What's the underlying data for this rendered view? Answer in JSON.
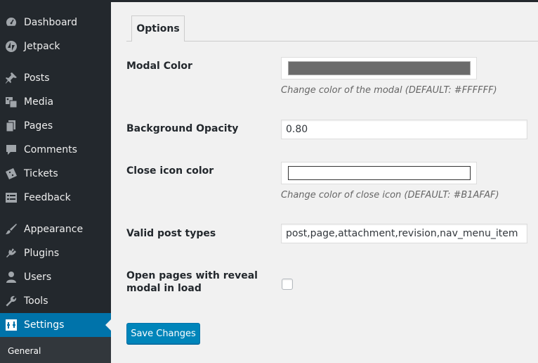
{
  "sidebar": {
    "items": [
      {
        "label": "Dashboard",
        "icon": "dashboard-icon"
      },
      {
        "label": "Jetpack",
        "icon": "jetpack-icon"
      },
      {
        "label": "Posts",
        "icon": "pin-icon"
      },
      {
        "label": "Media",
        "icon": "media-icon"
      },
      {
        "label": "Pages",
        "icon": "pages-icon"
      },
      {
        "label": "Comments",
        "icon": "comment-icon"
      },
      {
        "label": "Tickets",
        "icon": "tickets-icon"
      },
      {
        "label": "Feedback",
        "icon": "feedback-icon"
      },
      {
        "label": "Appearance",
        "icon": "brush-icon"
      },
      {
        "label": "Plugins",
        "icon": "plug-icon"
      },
      {
        "label": "Users",
        "icon": "user-icon"
      },
      {
        "label": "Tools",
        "icon": "wrench-icon"
      },
      {
        "label": "Settings",
        "icon": "settings-icon",
        "active": true
      }
    ],
    "submenu": {
      "label": "General"
    }
  },
  "tabs": [
    {
      "label": "Options",
      "active": true
    }
  ],
  "form": {
    "modal_color": {
      "label": "Modal Color",
      "swatch_color": "#6b6b6b",
      "description": "Change color of the modal (DEFAULT: #FFFFFF)"
    },
    "background_opacity": {
      "label": "Background Opacity",
      "value": "0.80"
    },
    "close_icon_color": {
      "label": "Close icon color",
      "swatch_color": "#ffffff",
      "description": "Change color of close icon (DEFAULT: #B1AFAF)"
    },
    "valid_post_types": {
      "label": "Valid post types",
      "value": "post,page,attachment,revision,nav_menu_item"
    },
    "open_pages": {
      "label_line1": "Open pages with reveal",
      "label_line2": "modal in load",
      "checked": false
    }
  },
  "save_button": {
    "label": "Save Changes"
  },
  "colors": {
    "sidebar_bg": "#23282d",
    "active_menu": "#0073aa",
    "primary_button": "#0085ba",
    "page_bg": "#f1f1f1"
  }
}
